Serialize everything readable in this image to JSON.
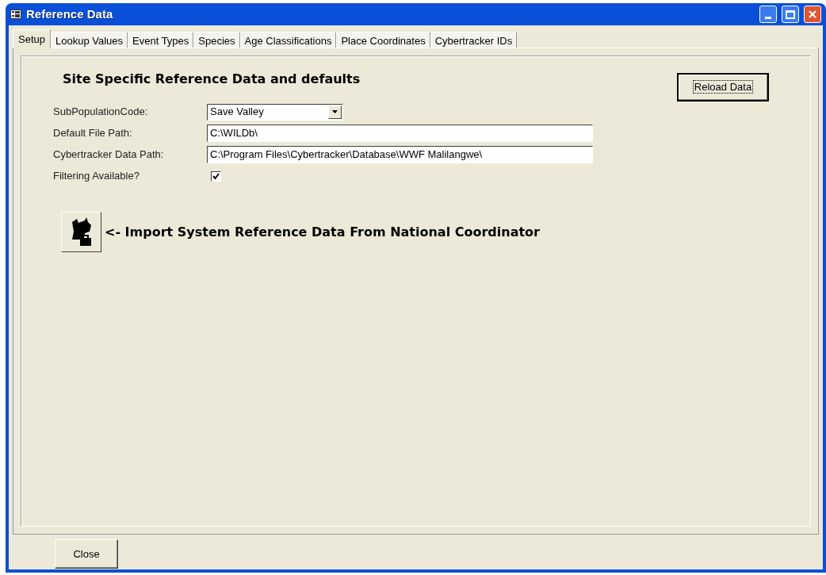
{
  "window": {
    "title": "Reference Data"
  },
  "tabs": [
    {
      "label": "Setup",
      "selected": true
    },
    {
      "label": "Lookup Values",
      "selected": false
    },
    {
      "label": "Event Types",
      "selected": false
    },
    {
      "label": "Species",
      "selected": false
    },
    {
      "label": "Age Classifications",
      "selected": false
    },
    {
      "label": "Place Coordinates",
      "selected": false
    },
    {
      "label": "Cybertracker IDs",
      "selected": false
    }
  ],
  "heading": "Site Specific Reference Data and defaults",
  "reload_button": "Reload Data",
  "fields": [
    {
      "kind": "dropdown",
      "label": "SubPopulationCode:",
      "value": "Save Valley"
    },
    {
      "kind": "text",
      "label": "Default File Path:",
      "value": "C:\\WILDb\\"
    },
    {
      "kind": "text",
      "label": "Cybertracker Data Path:",
      "value": "C:\\Program Files\\Cybertracker\\Database\\WWF Malilangwe\\"
    },
    {
      "kind": "checkbox",
      "label": "Filtering Available?",
      "checked": true
    }
  ],
  "import_label": "<- Import System Reference Data From National Coordinator",
  "close_button": "Close"
}
